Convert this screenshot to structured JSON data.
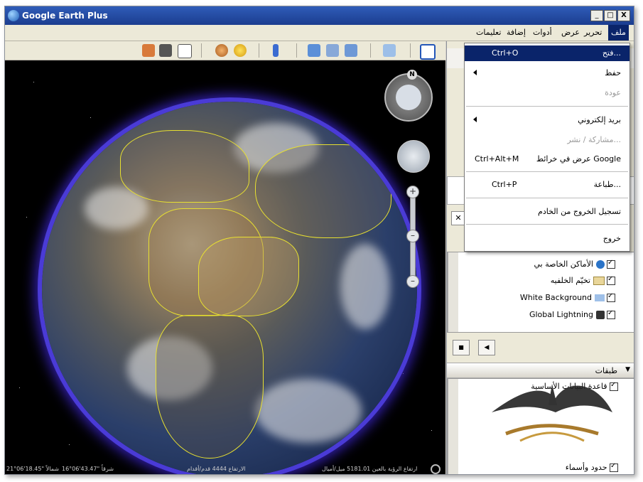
{
  "window": {
    "title": "Google Earth Plus",
    "controls": [
      "_",
      "□",
      "X"
    ]
  },
  "menubar": {
    "items": [
      {
        "label": "ملف",
        "active": true
      },
      {
        "label": "تحرير"
      },
      {
        "label": "عرض"
      },
      {
        "label": "أدوات"
      },
      {
        "label": "إضافة"
      },
      {
        "label": "تعليمات"
      }
    ]
  },
  "toolbar": {
    "icons": [
      "sidebar-toggle-icon",
      "add-placemark-icon",
      "add-polygon-icon",
      "add-path-icon",
      "add-image-overlay-icon",
      "ruler-icon",
      "sun-icon",
      "planets-icon",
      "email-icon",
      "print-icon",
      "google-maps-icon"
    ]
  },
  "file_menu": {
    "items": [
      {
        "label": "فتح...",
        "shortcut": "Ctrl+O",
        "selected": true
      },
      {
        "label": "حفظ",
        "submenu": true
      },
      {
        "label": "عودة",
        "disabled": true
      },
      {
        "sep": true
      },
      {
        "label": "بريد إلكتروني",
        "submenu": true
      },
      {
        "label": "مشاركة / نشر...",
        "disabled": true
      },
      {
        "label": "عرض في خرائط Google",
        "shortcut": "Ctrl+Alt+M"
      },
      {
        "sep": true
      },
      {
        "label": "طباعة...",
        "shortcut": "Ctrl+P"
      },
      {
        "sep": true
      },
      {
        "label": "تسجيل الخروج من الخادم"
      },
      {
        "sep": true
      },
      {
        "label": "خروج"
      }
    ]
  },
  "places": {
    "items": [
      {
        "label": "الأماكن الخاصة بي",
        "checked": true
      },
      {
        "label": "تخيّم الخلفيه",
        "checked": true
      },
      {
        "label": "White Background",
        "checked": true
      },
      {
        "label": "Global Lightning",
        "checked": true
      }
    ]
  },
  "layers": {
    "header": "طبقات",
    "items": [
      {
        "label": "قاعدة البيانات الأساسية",
        "checked": true
      },
      {
        "label": "حدود وأسماء",
        "checked": true
      }
    ]
  },
  "nav": {
    "north_label": "N"
  },
  "status": {
    "lat": "21°06'18.45\" شمالاً",
    "lon": "16°06'43.47\" شرقاً",
    "elevation": "الارتفاع 4444 قدم/أقدام",
    "eye_alt": "ارتفاع الرؤية بالعين 5181.01 ميل/أميال"
  }
}
